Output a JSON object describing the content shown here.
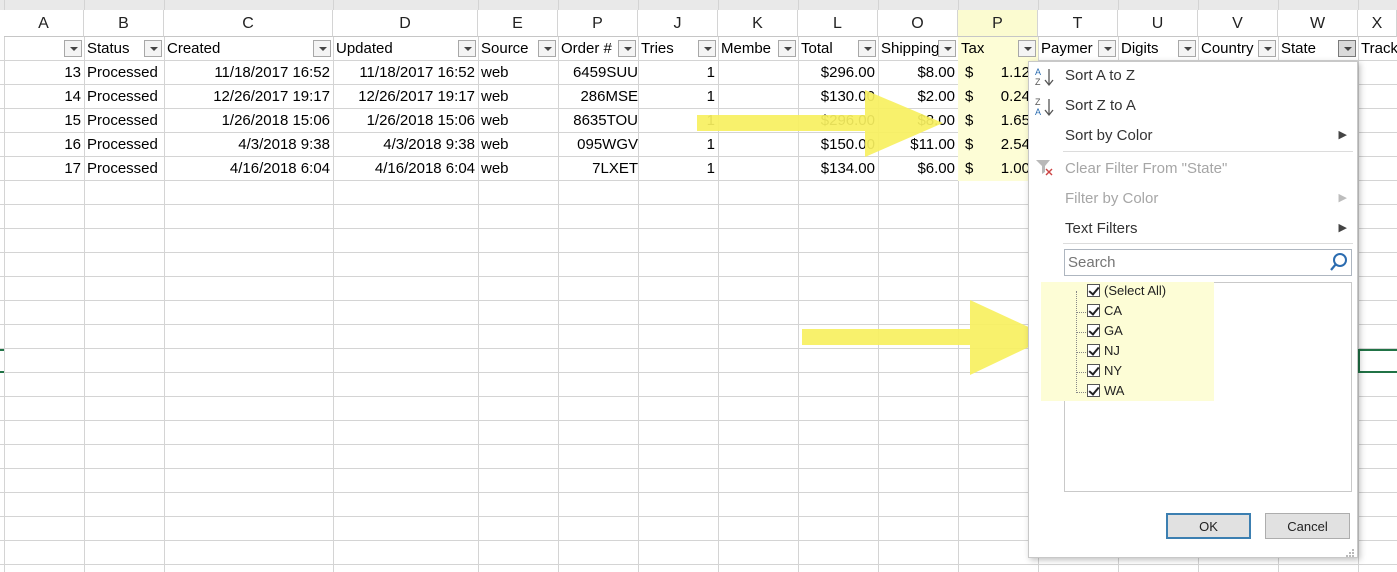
{
  "column_letters": [
    "A",
    "B",
    "C",
    "D",
    "E",
    "J",
    "K",
    "L",
    "O",
    "P",
    "T",
    "U",
    "V",
    "W",
    "X"
  ],
  "selected_column_letter": "P",
  "headers": [
    "",
    "Status",
    "Created",
    "Updated",
    "Source",
    "Order #",
    "Tries",
    "Membe",
    "Total",
    "Shipping",
    "Tax",
    "Paymer",
    "Digits",
    "Country",
    "State",
    "Track"
  ],
  "rows": [
    {
      "a": "13",
      "status": "Processed",
      "created": "11/18/2017 16:52",
      "updated": "11/18/2017 16:52",
      "source": "web",
      "order": "6459SUU",
      "tries": "1",
      "total": "$296.00",
      "shipping": "$8.00",
      "tax_sym": "$",
      "tax": "1.12"
    },
    {
      "a": "14",
      "status": "Processed",
      "created": "12/26/2017 19:17",
      "updated": "12/26/2017 19:17",
      "source": "web",
      "order": "286MSE",
      "tries": "1",
      "total": "$130.00",
      "shipping": "$2.00",
      "tax_sym": "$",
      "tax": "0.24"
    },
    {
      "a": "15",
      "status": "Processed",
      "created": "1/26/2018 15:06",
      "updated": "1/26/2018 15:06",
      "source": "web",
      "order": "8635TOU",
      "tries": "1",
      "total": "$296.00",
      "shipping": "$8.00",
      "tax_sym": "$",
      "tax": "1.65"
    },
    {
      "a": "16",
      "status": "Processed",
      "created": "4/3/2018 9:38",
      "updated": "4/3/2018 9:38",
      "source": "web",
      "order": "095WGV",
      "tries": "1",
      "total": "$150.00",
      "shipping": "$11.00",
      "tax_sym": "$",
      "tax": "2.54"
    },
    {
      "a": "17",
      "status": "Processed",
      "created": "4/16/2018 6:04",
      "updated": "4/16/2018 6:04",
      "source": "web",
      "order": "7LXET",
      "tries": "1",
      "total": "$134.00",
      "shipping": "$6.00",
      "tax_sym": "$",
      "tax": "1.00"
    }
  ],
  "filter_menu": {
    "sort_az": "Sort A to Z",
    "sort_za": "Sort Z to A",
    "sort_by_color": "Sort by Color",
    "clear_filter": "Clear Filter From \"State\"",
    "filter_by_color": "Filter by Color",
    "text_filters": "Text Filters",
    "search_placeholder": "Search",
    "items": [
      "(Select All)",
      "CA",
      "GA",
      "NJ",
      "NY",
      "WA"
    ],
    "ok": "OK",
    "cancel": "Cancel"
  },
  "colors": {
    "highlight": "#fdfdd6",
    "arrow": "#f7f060",
    "selection": "#217346"
  }
}
